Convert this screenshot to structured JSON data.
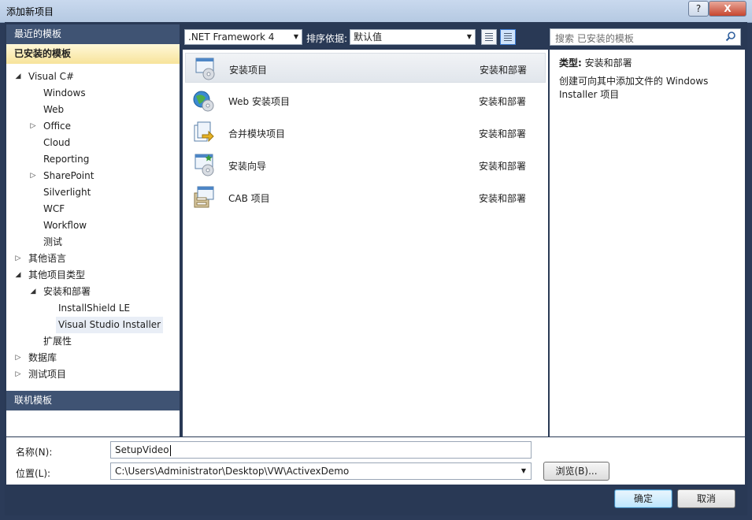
{
  "window": {
    "title": "添加新项目",
    "help_label": "?",
    "close_label": "X"
  },
  "left": {
    "recent_header": "最近的模板",
    "installed_header": "已安装的模板",
    "online_header": "联机模板",
    "tree": [
      {
        "label": "Visual C#",
        "level": 0,
        "toggle": "expanded"
      },
      {
        "label": "Windows",
        "level": 1,
        "toggle": "none"
      },
      {
        "label": "Web",
        "level": 1,
        "toggle": "none"
      },
      {
        "label": "Office",
        "level": 1,
        "toggle": "collapsed"
      },
      {
        "label": "Cloud",
        "level": 1,
        "toggle": "none"
      },
      {
        "label": "Reporting",
        "level": 1,
        "toggle": "none"
      },
      {
        "label": "SharePoint",
        "level": 1,
        "toggle": "collapsed"
      },
      {
        "label": "Silverlight",
        "level": 1,
        "toggle": "none"
      },
      {
        "label": "WCF",
        "level": 1,
        "toggle": "none"
      },
      {
        "label": "Workflow",
        "level": 1,
        "toggle": "none"
      },
      {
        "label": "测试",
        "level": 1,
        "toggle": "none"
      },
      {
        "label": "其他语言",
        "level": 0,
        "toggle": "collapsed"
      },
      {
        "label": "其他项目类型",
        "level": 0,
        "toggle": "expanded"
      },
      {
        "label": "安装和部署",
        "level": 1,
        "toggle": "expanded"
      },
      {
        "label": "InstallShield LE",
        "level": 2,
        "toggle": "none"
      },
      {
        "label": "Visual Studio Installer",
        "level": 2,
        "toggle": "none",
        "selected": true
      },
      {
        "label": "扩展性",
        "level": 1,
        "toggle": "none"
      },
      {
        "label": "数据库",
        "level": 0,
        "toggle": "collapsed"
      },
      {
        "label": "测试项目",
        "level": 0,
        "toggle": "collapsed"
      }
    ]
  },
  "toolbar": {
    "framework": ".NET Framework 4",
    "sort_label": "排序依据:",
    "sort_value": "默认值",
    "search_placeholder": "搜索 已安装的模板"
  },
  "templates": [
    {
      "name": "安装项目",
      "category": "安装和部署",
      "icon": "setup-project-icon",
      "selected": true
    },
    {
      "name": "Web 安装项目",
      "category": "安装和部署",
      "icon": "web-setup-project-icon"
    },
    {
      "name": "合并模块项目",
      "category": "安装和部署",
      "icon": "merge-module-project-icon"
    },
    {
      "name": "安装向导",
      "category": "安装和部署",
      "icon": "setup-wizard-icon"
    },
    {
      "name": "CAB 项目",
      "category": "安装和部署",
      "icon": "cab-project-icon"
    }
  ],
  "detail": {
    "type_label": "类型:",
    "type_value": "安装和部署",
    "description": "创建可向其中添加文件的 Windows Installer 项目"
  },
  "form": {
    "name_label": "名称(N):",
    "name_value": "SetupVideo",
    "location_label": "位置(L):",
    "location_value": "C:\\Users\\Administrator\\Desktop\\VW\\ActivexDemo",
    "browse_label": "浏览(B)...",
    "ok_label": "确定",
    "cancel_label": "取消"
  }
}
